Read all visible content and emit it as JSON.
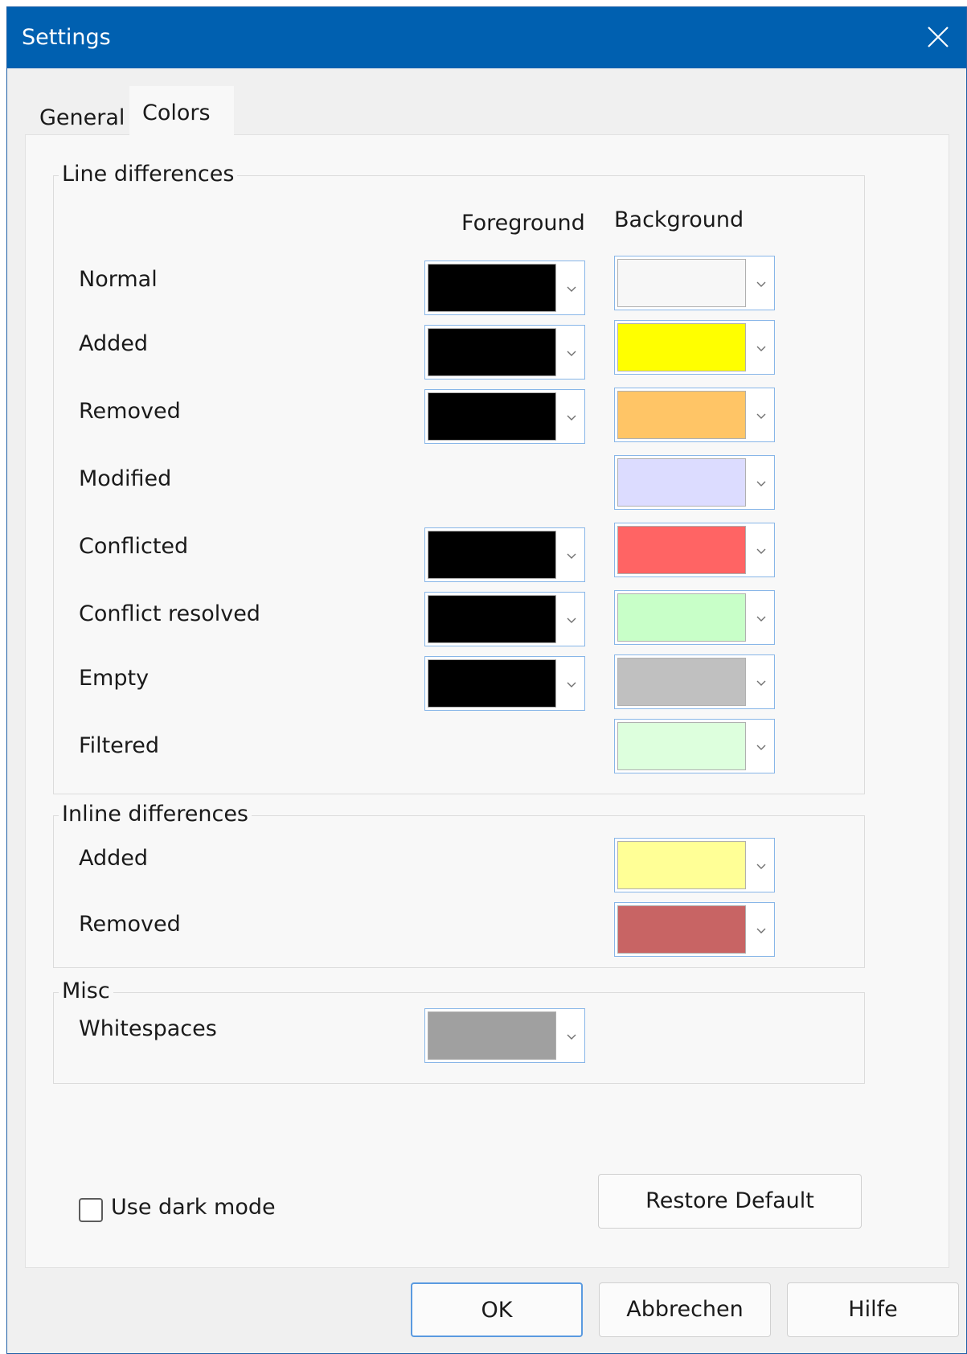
{
  "window": {
    "title": "Settings"
  },
  "tabs": [
    {
      "label": "General",
      "active": false
    },
    {
      "label": "Colors",
      "active": true
    }
  ],
  "line_differences": {
    "title": "Line differences",
    "foreground_header": "Foreground",
    "background_header": "Background",
    "rows": [
      {
        "label": "Normal",
        "foreground": "#000000",
        "background": "#f7f7f7"
      },
      {
        "label": "Added",
        "foreground": "#000000",
        "background": "#ffff00"
      },
      {
        "label": "Removed",
        "foreground": "#000000",
        "background": "#ffc566"
      },
      {
        "label": "Modified",
        "foreground": null,
        "background": "#dcdcff"
      },
      {
        "label": "Conflicted",
        "foreground": "#000000",
        "background": "#ff6464"
      },
      {
        "label": "Conflict resolved",
        "foreground": "#000000",
        "background": "#c8ffc8"
      },
      {
        "label": "Empty",
        "foreground": "#000000",
        "background": "#c0c0c0"
      },
      {
        "label": "Filtered",
        "foreground": null,
        "background": "#ddffdd"
      }
    ]
  },
  "inline_differences": {
    "title": "Inline differences",
    "rows": [
      {
        "label": "Added",
        "background": "#ffff96"
      },
      {
        "label": "Removed",
        "background": "#c86464"
      }
    ]
  },
  "misc": {
    "title": "Misc",
    "rows": [
      {
        "label": "Whitespaces",
        "foreground": "#a0a0a0"
      }
    ]
  },
  "dark_mode": {
    "label": "Use dark mode",
    "checked": false
  },
  "buttons": {
    "restore_default": "Restore Default",
    "ok": "OK",
    "cancel": "Abbrechen",
    "help": "Hilfe"
  },
  "colors": {
    "titlebar": "#0060b0",
    "focus_border": "#5a9ae0"
  }
}
